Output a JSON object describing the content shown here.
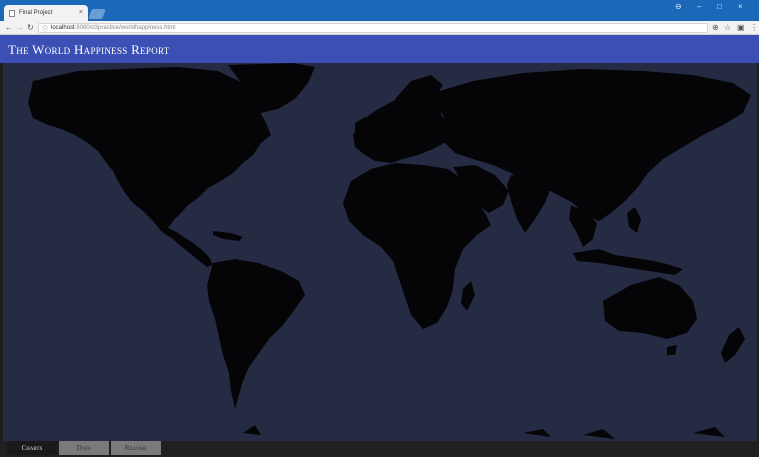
{
  "browser": {
    "tab_title": "Final Project",
    "tab_close": "×",
    "url_host": "localhost",
    "url_path": ":8080/d3practice/worldhappiness.html",
    "window_controls": [
      "–",
      "□",
      "×"
    ]
  },
  "page": {
    "title": "The World Happiness Report"
  },
  "bottom_tabs": [
    {
      "label": "Charts",
      "active": true
    },
    {
      "label": "Data",
      "active": false
    },
    {
      "label": "Readme",
      "active": false
    }
  ],
  "map": {
    "ocean_color": "#262b44",
    "land_color": "#050507"
  }
}
